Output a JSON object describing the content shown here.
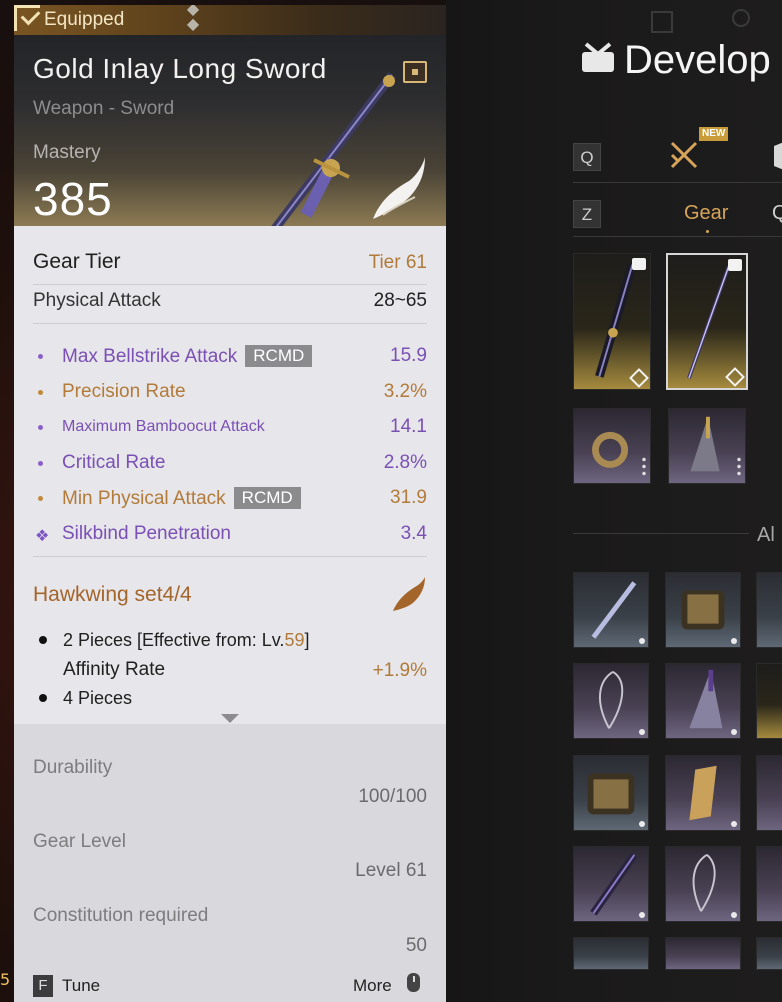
{
  "tooltip": {
    "equipped_label": "Equipped",
    "item_name": "Gold Inlay Long Sword",
    "item_type": "Weapon - Sword",
    "mastery_label": "Mastery",
    "mastery_value": "385",
    "gear_tier_label": "Gear Tier",
    "gear_tier_value": "Tier 61",
    "physical_attack_label": "Physical Attack",
    "physical_attack_value": "28~65",
    "stats": [
      {
        "label": "Max Bellstrike Attack",
        "value": "15.9",
        "rcmd": "RCMD",
        "color": "#7a50b4"
      },
      {
        "label": "Precision Rate",
        "value": "3.2%",
        "rcmd": "",
        "color": "#b27b3a"
      },
      {
        "label": "Maximum Bamboocut Attack",
        "value": "14.1",
        "rcmd": "",
        "color": "#7a50b4"
      },
      {
        "label": "Critical Rate",
        "value": "2.8%",
        "rcmd": "",
        "color": "#7a50b4"
      },
      {
        "label": "Min Physical Attack",
        "value": "31.9",
        "rcmd": "RCMD",
        "color": "#b27b3a"
      },
      {
        "label": "Silkbind Penetration",
        "value": "3.4",
        "rcmd": "",
        "color": "#7a50b4"
      }
    ],
    "set": {
      "title": "Hawkwing set4/4",
      "piece2_prefix": "2 Pieces [Effective from: Lv.",
      "piece2_level": "59",
      "piece2_suffix": "]",
      "piece2_bonus_label": "Affinity Rate",
      "piece2_bonus_value": "+1.9%",
      "piece4": "4 Pieces"
    },
    "durability_label": "Durability",
    "durability_value": "100/100",
    "gear_level_label": "Gear Level",
    "gear_level_value": "Level 61",
    "constitution_label": "Constitution required",
    "constitution_value": "50",
    "footer": {
      "tune_key": "F",
      "tune_label": "Tune",
      "more_label": "More"
    }
  },
  "panel": {
    "title": "Develop",
    "key_q": "Q",
    "key_z": "Z",
    "new_badge": "NEW",
    "tab_gear": "Gear",
    "tab_next": "Q",
    "all_label": "Al"
  },
  "left_edge_number": "5",
  "colors": {
    "purple_stat": "#7a50b4",
    "gold_stat": "#b27b3a",
    "accent_tab": "#d7a45a"
  }
}
